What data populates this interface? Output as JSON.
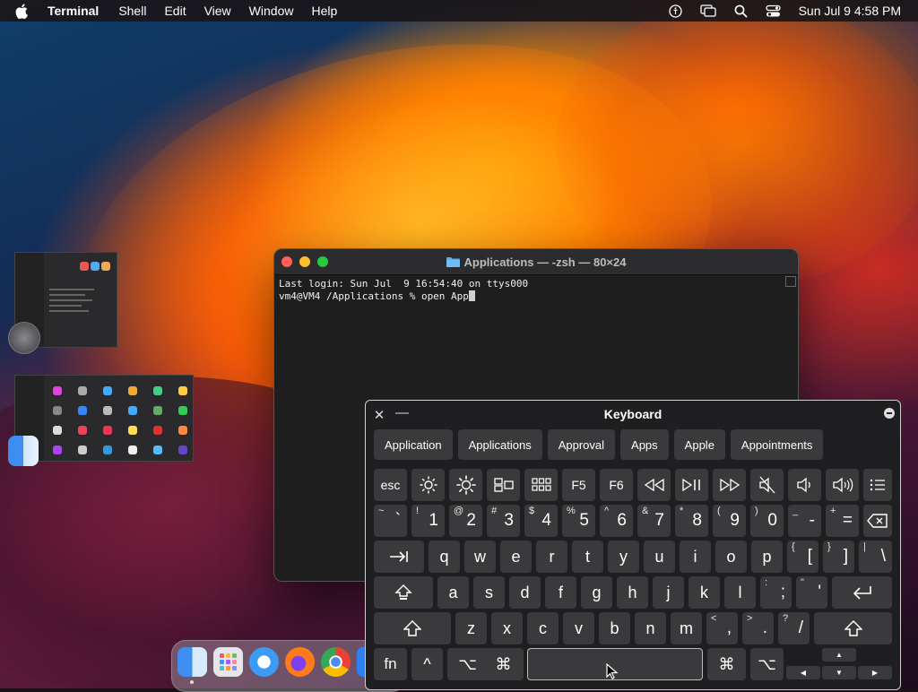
{
  "menubar": {
    "app_name": "Terminal",
    "items": [
      "Shell",
      "Edit",
      "View",
      "Window",
      "Help"
    ],
    "clock": "Sun Jul 9  4:58 PM"
  },
  "terminal": {
    "title": "Applications — -zsh — 80×24",
    "lines": [
      "Last login: Sun Jul  9 16:54:40 on ttys000",
      "vm4@VM4 /Applications % open App"
    ]
  },
  "keyboard": {
    "title": "Keyboard",
    "suggestions": [
      "Application",
      "Applications",
      "Approval",
      "Apps",
      "Apple",
      "Appointments"
    ],
    "fn_row": [
      "esc",
      "brightness-down-icon",
      "brightness-up-icon",
      "mission-control-icon",
      "launchpad-icon",
      "F5",
      "F6",
      "rewind-icon",
      "play-pause-icon",
      "fast-forward-icon",
      "mute-icon",
      "volume-down-icon",
      "volume-up-icon",
      "list-icon"
    ],
    "number_row": [
      {
        "shift": "~",
        "main": "`"
      },
      {
        "shift": "!",
        "main": "1"
      },
      {
        "shift": "@",
        "main": "2"
      },
      {
        "shift": "#",
        "main": "3"
      },
      {
        "shift": "$",
        "main": "4"
      },
      {
        "shift": "%",
        "main": "5"
      },
      {
        "shift": "^",
        "main": "6"
      },
      {
        "shift": "&",
        "main": "7"
      },
      {
        "shift": "*",
        "main": "8"
      },
      {
        "shift": "(",
        "main": "9"
      },
      {
        "shift": ")",
        "main": "0"
      },
      {
        "shift": "_",
        "main": "-"
      },
      {
        "shift": "+",
        "main": "="
      }
    ],
    "row_q": [
      "q",
      "w",
      "e",
      "r",
      "t",
      "y",
      "u",
      "i",
      "o",
      "p"
    ],
    "row_q_extra": [
      {
        "shift": "{",
        "main": "["
      },
      {
        "shift": "}",
        "main": "]"
      },
      {
        "shift": "|",
        "main": "\\"
      }
    ],
    "row_a": [
      "a",
      "s",
      "d",
      "f",
      "g",
      "h",
      "j",
      "k",
      "l"
    ],
    "row_a_extra": [
      {
        "shift": ":",
        "main": ";"
      },
      {
        "shift": "\"",
        "main": "'"
      }
    ],
    "row_z": [
      "z",
      "x",
      "c",
      "v",
      "b",
      "n",
      "m"
    ],
    "row_z_extra": [
      {
        "shift": "<",
        "main": ","
      },
      {
        "shift": ">",
        "main": "."
      },
      {
        "shift": "?",
        "main": "/"
      }
    ],
    "bottom": {
      "fn": "fn",
      "control": "^",
      "option": "⌥",
      "command": "⌘"
    }
  },
  "colors": {
    "close": "#ff5f57",
    "minimize": "#febc2e",
    "zoom": "#28c840",
    "key_bg": "#3a3a3c"
  }
}
